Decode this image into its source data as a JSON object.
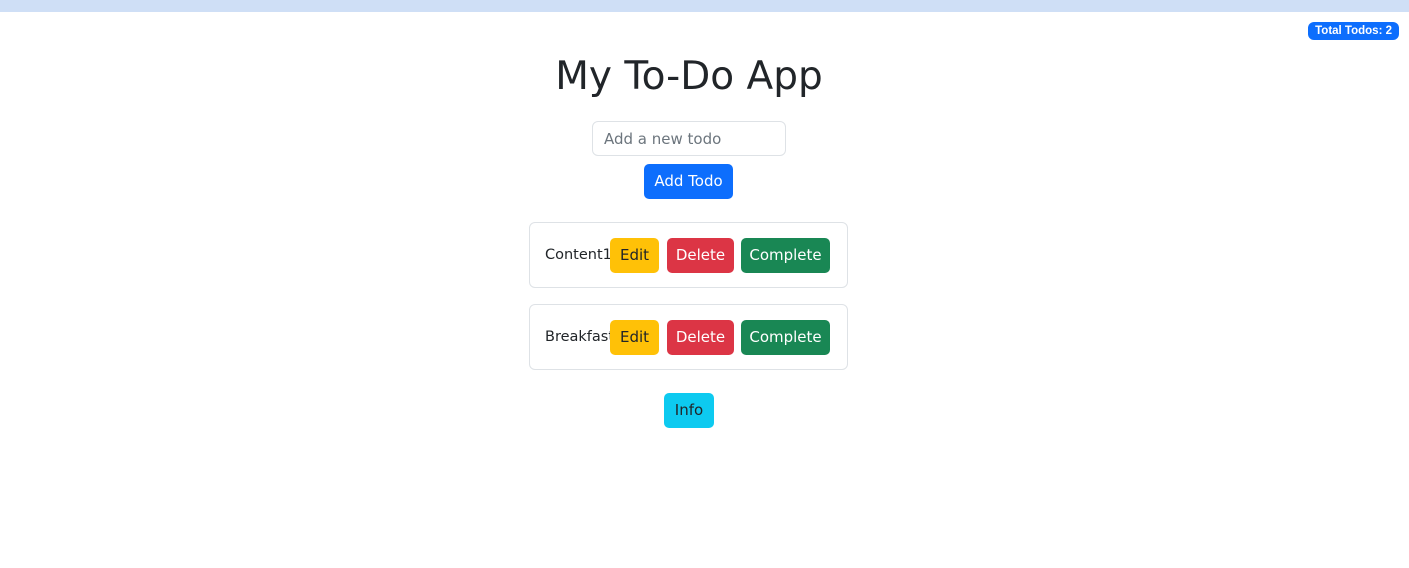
{
  "badge": {
    "total_label": "Total Todos: 2"
  },
  "header": {
    "title": "My To-Do App"
  },
  "form": {
    "input_placeholder": "Add a new todo",
    "input_value": "",
    "add_label": "Add Todo"
  },
  "todos": [
    {
      "text": "Content1",
      "edit_label": "Edit",
      "delete_label": "Delete",
      "complete_label": "Complete"
    },
    {
      "text": "Breakfast",
      "edit_label": "Edit",
      "delete_label": "Delete",
      "complete_label": "Complete"
    }
  ],
  "footer": {
    "info_label": "Info"
  },
  "colors": {
    "primary": "#0d6efd",
    "warning": "#ffc107",
    "danger": "#dc3545",
    "success": "#198754",
    "info": "#0dcaf0"
  }
}
